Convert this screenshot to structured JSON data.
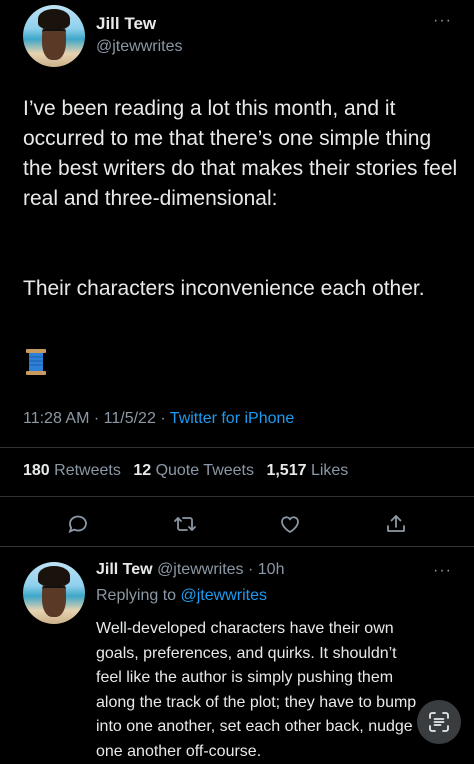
{
  "main_tweet": {
    "author_name": "Jill Tew",
    "author_handle": "@jtewwrites",
    "more_label": "···",
    "paragraph_1": "I’ve been reading a lot this month, and it occurred to me that there’s one simple thing the best writers do that makes their stories feel real and three-dimensional:",
    "paragraph_2": "Their characters inconvenience each other.",
    "emoji": "thread-spool",
    "time": "11:28 AM",
    "date": "11/5/22",
    "source": "Twitter for iPhone",
    "separator": "·"
  },
  "stats": {
    "retweets_count": "180",
    "retweets_label": "Retweets",
    "quotes_count": "12",
    "quotes_label": "Quote Tweets",
    "likes_count": "1,517",
    "likes_label": "Likes"
  },
  "actions": {
    "icons": [
      "reply-icon",
      "retweet-icon",
      "like-icon",
      "share-icon"
    ]
  },
  "reply_tweet": {
    "author_name": "Jill Tew",
    "author_handle": "@jtewwrites",
    "separator": "·",
    "age": "10h",
    "more_label": "···",
    "replying_prefix": "Replying to",
    "replying_handle": "@jtewwrites",
    "text": "Well-developed characters have their own goals, preferences, and quirks. It shouldn’t feel like the author is simply pushing them along the track of the plot; they have to bump into one another, set each other back, nudge one another off-course."
  },
  "colors": {
    "background": "#000000",
    "text": "#e7e9ea",
    "secondary": "#8b98a5",
    "accent": "#1d9bf0",
    "divider": "#2f3336"
  }
}
